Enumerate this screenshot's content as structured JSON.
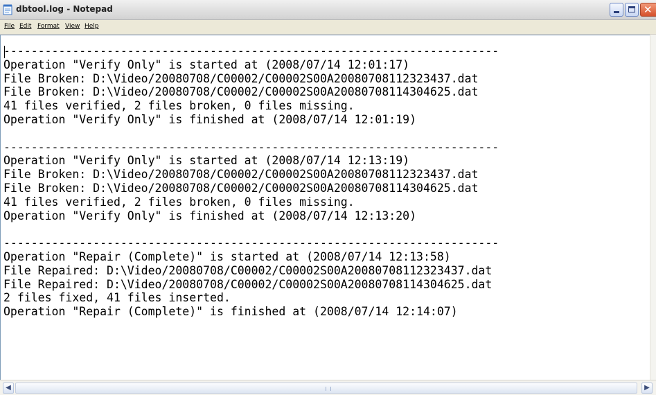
{
  "window": {
    "title": "dbtool.log - Notepad"
  },
  "menu": [
    {
      "label": "File"
    },
    {
      "label": "Edit"
    },
    {
      "label": "Format"
    },
    {
      "label": "View"
    },
    {
      "label": "Help"
    }
  ],
  "icons": {
    "app": "notepad-icon",
    "minimize": "minimize-icon",
    "maximize": "maximize-icon",
    "close": "close-icon",
    "scroll_left": "arrow-left-icon",
    "scroll_right": "arrow-right-icon"
  },
  "editor": {
    "content": "------------------------------------------------------------------------\nOperation \"Verify Only\" is started at (2008/07/14 12:01:17)\nFile Broken: D:\\Video/20080708/C00002/C00002S00A20080708112323437.dat\nFile Broken: D:\\Video/20080708/C00002/C00002S00A20080708114304625.dat\n41 files verified, 2 files broken, 0 files missing.\nOperation \"Verify Only\" is finished at (2008/07/14 12:01:19)\n\n------------------------------------------------------------------------\nOperation \"Verify Only\" is started at (2008/07/14 12:13:19)\nFile Broken: D:\\Video/20080708/C00002/C00002S00A20080708112323437.dat\nFile Broken: D:\\Video/20080708/C00002/C00002S00A20080708114304625.dat\n41 files verified, 2 files broken, 0 files missing.\nOperation \"Verify Only\" is finished at (2008/07/14 12:13:20)\n\n------------------------------------------------------------------------\nOperation \"Repair (Complete)\" is started at (2008/07/14 12:13:58)\nFile Repaired: D:\\Video/20080708/C00002/C00002S00A20080708112323437.dat\nFile Repaired: D:\\Video/20080708/C00002/C00002S00A20080708114304625.dat\n2 files fixed, 41 files inserted.\nOperation \"Repair (Complete)\" is finished at (2008/07/14 12:14:07)"
  },
  "colors": {
    "titlebar": "#e2e2e2",
    "close_button": "#d5512b",
    "menubar": "#ece9d8",
    "editor_background": "#ffffff"
  }
}
